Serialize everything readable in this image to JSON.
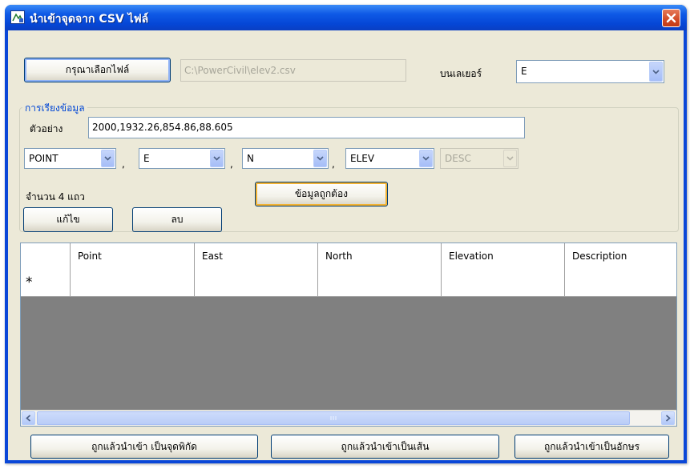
{
  "window": {
    "title": "นำเข้าจุดจาก CSV ไฟล์"
  },
  "file": {
    "browse_label": "กรุณาเลือกไฟล์",
    "path": "C:\\PowerCivil\\elev2.csv"
  },
  "layer": {
    "label": "บนเลเยอร์",
    "value": "E"
  },
  "format": {
    "group_title": "การเรียงข้อมูล",
    "sample_label": "ตัวอย่าง",
    "sample_value": "2000,1932.26,854.86,88.605",
    "fields": [
      "POINT",
      "E",
      "N",
      "ELEV",
      "DESC"
    ],
    "separator": ",",
    "row_count_text": "จำนวน  4  แถว",
    "validate_label": "ข้อมูลถูกต้อง",
    "edit_label": "แก้ไข",
    "delete_label": "ลบ"
  },
  "grid": {
    "columns": [
      "Point",
      "East",
      "North",
      "Elevation",
      "Description"
    ],
    "new_row_marker": "*"
  },
  "actions": {
    "import_points": "ถูกแล้วนำเข้า เป็นจุดพิกัด",
    "import_lines": "ถูกแล้วนำเข้าเป็นเส้น",
    "import_text": "ถูกแล้วนำเข้าเป็นอักษร"
  },
  "colors": {
    "titlebar": "#0546d6",
    "group_title": "#0046d5",
    "grid_empty": "#808080",
    "close_button": "#d24a25"
  }
}
